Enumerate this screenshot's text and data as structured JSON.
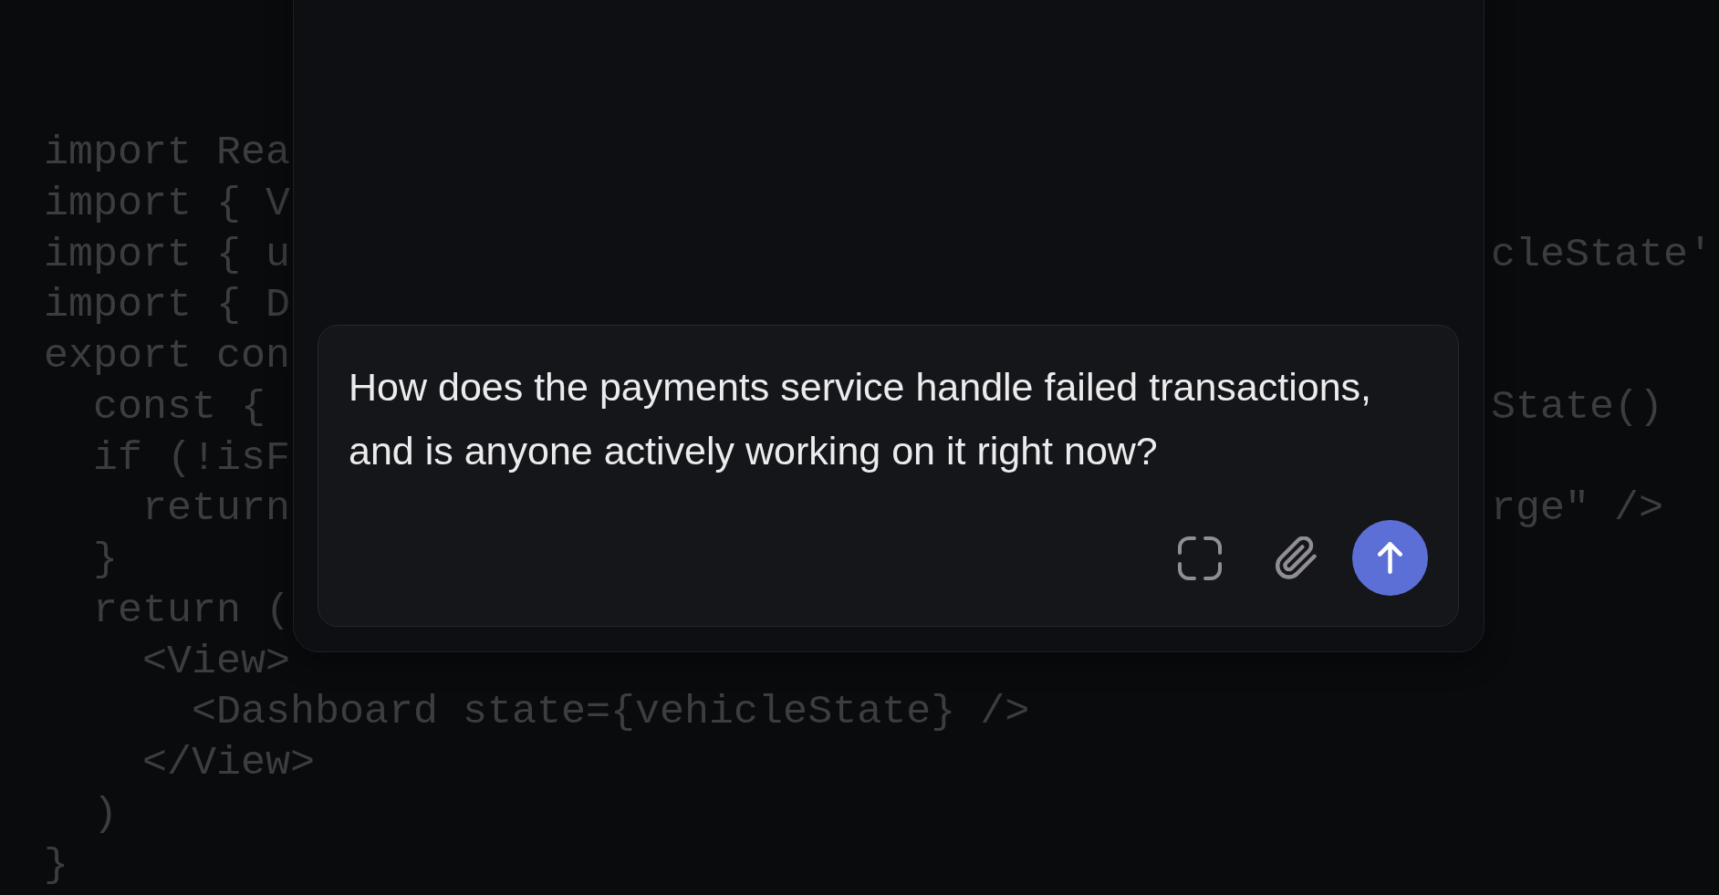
{
  "code": {
    "lines": [
      {
        "text": "import Rea"
      },
      {
        "text": "import { V"
      },
      {
        "text": "import { u",
        "right": "cleState'"
      },
      {
        "text": "import { D"
      },
      {
        "text": "export con",
        "children": [
          {
            "text": "const {",
            "right": "State()"
          },
          {
            "text": "if (!isF",
            "children": [
              {
                "text": "return",
                "right": "rge\" />"
              }
            ]
          },
          {
            "text": "}"
          },
          {
            "text": "return (",
            "children": [
              {
                "text": "<View>",
                "children": [
                  {
                    "text": "<Dashboard state={vehicleState} />"
                  }
                ]
              },
              {
                "text": "</View>"
              }
            ]
          },
          {
            "text": ")"
          }
        ]
      },
      {
        "text": "}"
      }
    ]
  },
  "composer": {
    "message": "How does the payments service handle failed transactions, and is anyone actively working on it right now?"
  }
}
